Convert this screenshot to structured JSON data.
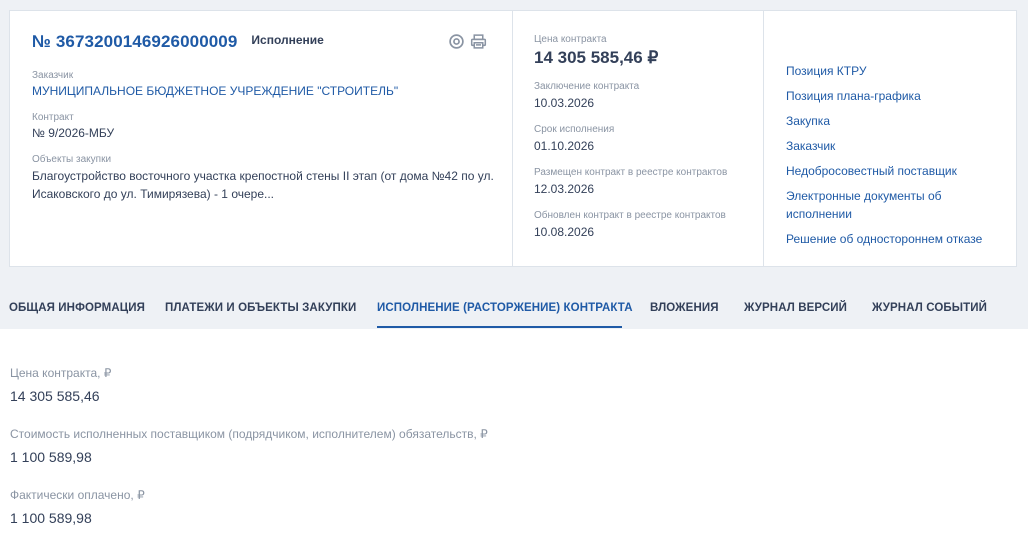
{
  "card": {
    "reg_number": "№ 3673200146926000009",
    "status": "Исполнение",
    "icons": [
      "target-icon",
      "print-icon"
    ],
    "customer": {
      "label": "Заказчик",
      "value": "МУНИЦИПАЛЬНОЕ БЮДЖЕТНОЕ УЧРЕЖДЕНИЕ \"СТРОИТЕЛЬ\""
    },
    "contract": {
      "label": "Контракт",
      "value": "№ 9/2026-МБУ"
    },
    "objects": {
      "label": "Объекты закупки",
      "value": "Благоустройство восточного участка крепостной стены II этап (от дома №42 по ул. Исаковского до ул. Тимирязева) - 1 очере..."
    },
    "price": {
      "label": "Цена контракта",
      "value": "14 305 585,46 ₽"
    },
    "conclusion": {
      "label": "Заключение контракта",
      "value": "10.03.2026"
    },
    "term": {
      "label": "Срок исполнения",
      "value": "01.10.2026"
    },
    "published": {
      "label": "Размещен контракт в реестре контрактов",
      "value": "12.03.2026"
    },
    "updated": {
      "label": "Обновлен контракт в реестре контрактов",
      "value": "10.08.2026"
    },
    "links": [
      "Позиция КТРУ",
      "Позиция плана-графика",
      "Закупка",
      "Заказчик",
      "Недобросовестный поставщик",
      "Электронные документы об исполнении",
      "Решение об одностороннем отказе"
    ]
  },
  "tabs": [
    "ОБЩАЯ ИНФОРМАЦИЯ",
    "ПЛАТЕЖИ И ОБЪЕКТЫ ЗАКУПКИ",
    "ИСПОЛНЕНИЕ (РАСТОРЖЕНИЕ) КОНТРАКТА",
    "ВЛОЖЕНИЯ",
    "ЖУРНАЛ ВЕРСИЙ",
    "ЖУРНАЛ СОБЫТИЙ"
  ],
  "active_tab": "ИСПОЛНЕНИЕ (РАСТОРЖЕНИЕ) КОНТРАКТА",
  "content": [
    {
      "label": "Цена контракта, ₽",
      "value": "14 305 585,46"
    },
    {
      "label": "Стоимость исполненных поставщиком (подрядчиком, исполнителем) обязательств, ₽",
      "value": "1 100 589,98"
    },
    {
      "label": "Фактически оплачено, ₽",
      "value": "1 100 589,98"
    }
  ],
  "colors": {
    "accent": "#1f5aa6",
    "text": "#334059",
    "muted": "#8a94a3",
    "background": "#eef1f5"
  }
}
